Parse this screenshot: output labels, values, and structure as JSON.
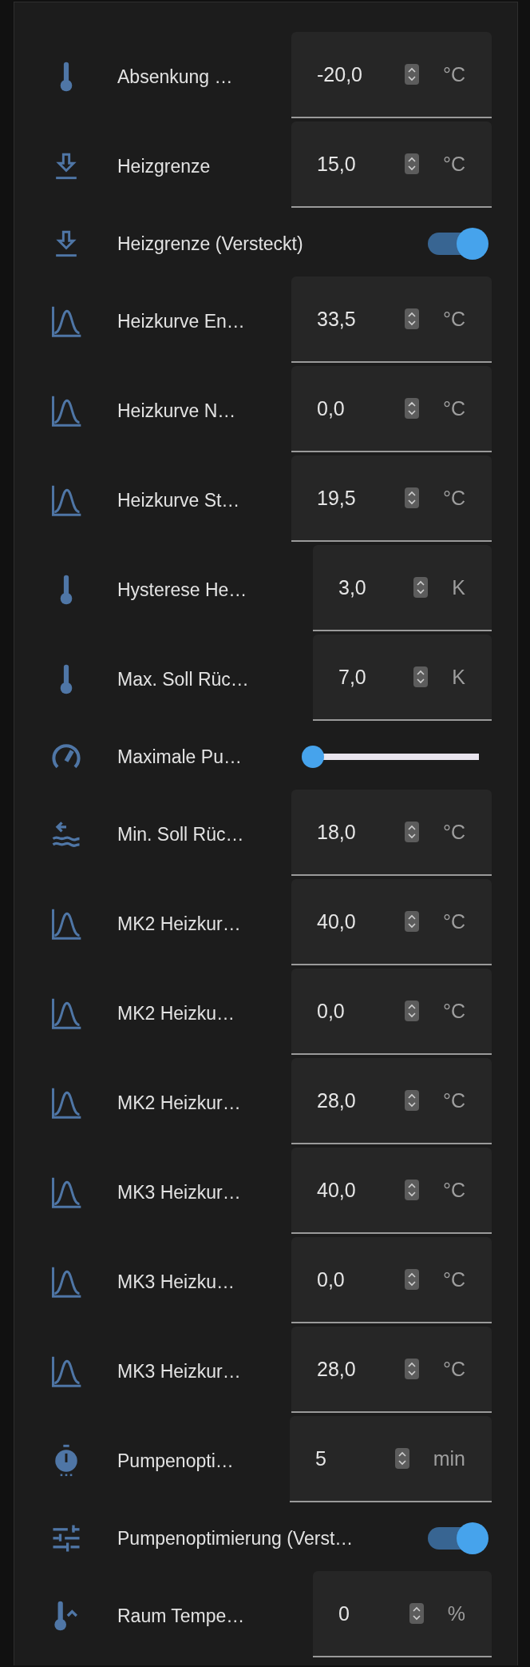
{
  "rows": [
    {
      "kind": "field",
      "label": "Absenkung …",
      "value": "-20,0",
      "unit": "°C"
    },
    {
      "kind": "field",
      "label": "Heizgrenze",
      "value": "15,0",
      "unit": "°C"
    },
    {
      "kind": "toggle",
      "label": "Heizgrenze (Versteckt)",
      "on": true
    },
    {
      "kind": "field",
      "label": "Heizkurve En…",
      "value": "33,5",
      "unit": "°C"
    },
    {
      "kind": "field",
      "label": "Heizkurve N…",
      "value": "0,0",
      "unit": "°C"
    },
    {
      "kind": "field",
      "label": "Heizkurve St…",
      "value": "19,5",
      "unit": "°C"
    },
    {
      "kind": "field",
      "label": "Hysterese He…",
      "value": "3,0",
      "unit": "K"
    },
    {
      "kind": "field",
      "label": "Max. Soll Rüc…",
      "value": "7,0",
      "unit": "K"
    },
    {
      "kind": "slider",
      "label": "Maximale Pu…",
      "level": 0
    },
    {
      "kind": "field",
      "label": "Min. Soll Rüc…",
      "value": "18,0",
      "unit": "°C"
    },
    {
      "kind": "field",
      "label": "MK2 Heizkur…",
      "value": "40,0",
      "unit": "°C"
    },
    {
      "kind": "field",
      "label": "MK2 Heizku…",
      "value": "0,0",
      "unit": "°C"
    },
    {
      "kind": "field",
      "label": "MK2 Heizkur…",
      "value": "28,0",
      "unit": "°C"
    },
    {
      "kind": "field",
      "label": "MK3 Heizkur…",
      "value": "40,0",
      "unit": "°C"
    },
    {
      "kind": "field",
      "label": "MK3 Heizku…",
      "value": "0,0",
      "unit": "°C"
    },
    {
      "kind": "field",
      "label": "MK3 Heizkur…",
      "value": "28,0",
      "unit": "°C"
    },
    {
      "kind": "field",
      "label": "Pumpenopti…",
      "value": "5",
      "unit": "min"
    },
    {
      "kind": "toggle",
      "label": "Pumpenoptimierung (Verst…",
      "on": true
    },
    {
      "kind": "field",
      "label": "Raum Tempe…",
      "value": "0",
      "unit": "%"
    }
  ]
}
